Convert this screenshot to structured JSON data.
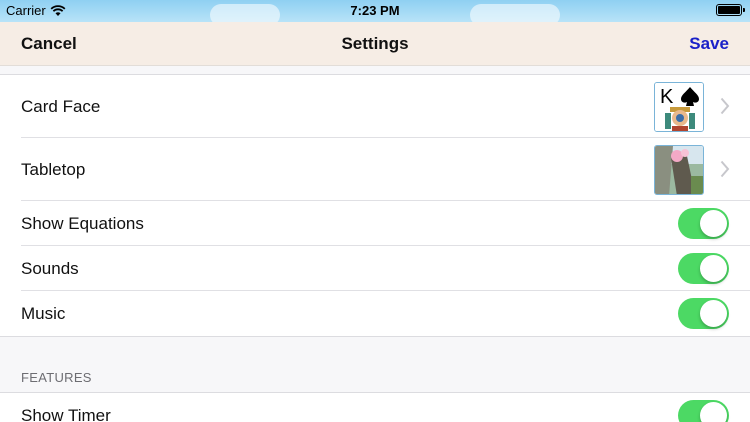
{
  "status_bar": {
    "carrier": "Carrier",
    "time": "7:23 PM",
    "icons": [
      "wifi-icon",
      "battery-icon"
    ]
  },
  "nav": {
    "cancel_label": "Cancel",
    "title": "Settings",
    "save_label": "Save",
    "save_color": "#1a21c8"
  },
  "settings": {
    "card_face": {
      "label": "Card Face",
      "icon": "king-of-spades-card-icon"
    },
    "tabletop": {
      "label": "Tabletop",
      "icon": "tabletop-scene-thumbnail"
    },
    "show_equations": {
      "label": "Show Equations",
      "on": true
    },
    "sounds": {
      "label": "Sounds",
      "on": true
    },
    "music": {
      "label": "Music",
      "on": true
    }
  },
  "features": {
    "header": "FEATURES",
    "show_timer": {
      "label": "Show Timer",
      "on": true
    }
  },
  "colors": {
    "toggle_on": "#4cd964",
    "nav_background": "#f6ede5"
  }
}
